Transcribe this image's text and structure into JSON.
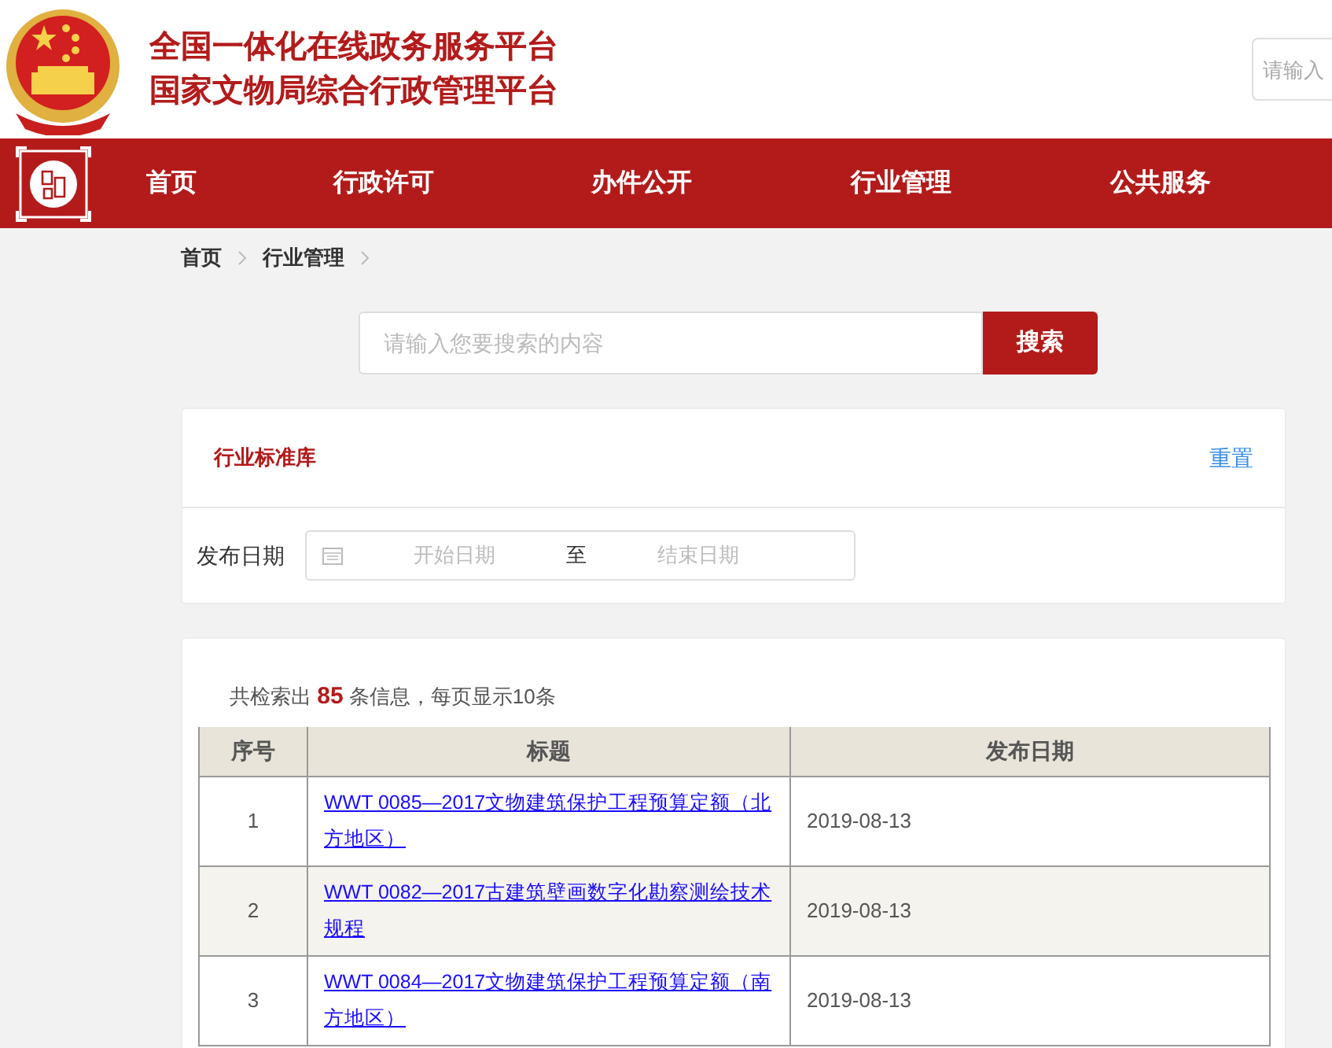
{
  "header": {
    "title_lines": [
      "全国一体化在线政务服务平台",
      "国家文物局综合行政管理平台"
    ],
    "search": {
      "placeholder": "请输入"
    }
  },
  "nav": {
    "items": [
      {
        "label": "首页",
        "selected": false
      },
      {
        "label": "行政许可",
        "selected": false
      },
      {
        "label": "办件公开",
        "selected": false
      },
      {
        "label": "行业管理",
        "selected": false
      },
      {
        "label": "公共服务",
        "selected": false
      }
    ]
  },
  "breadcrumb": [
    "首页",
    "行业管理"
  ],
  "search": {
    "placeholder": "请输入您要搜索的内容",
    "button": "搜索"
  },
  "filter": {
    "title": "行业标准库",
    "reset": "重置",
    "date_label": "发布日期",
    "start_placeholder": "开始日期",
    "separator": "至",
    "end_placeholder": "结束日期"
  },
  "results": {
    "summary": "共检索出 **85** 条信息，每页显示10条",
    "table": {
      "columns": [
        "序号",
        "标题",
        "发布日期"
      ],
      "rows": [
        {
          "no": "1",
          "title": "WWT 0085—2017文物建筑保护工程预算定额（北方地区）",
          "date": "2019-08-13"
        },
        {
          "no": "2",
          "title": "WWT 0082—2017古建筑壁画数字化勘察测绘技术规程",
          "date": "2019-08-13"
        },
        {
          "no": "3",
          "title": "WWT 0084—2017文物建筑保护工程预算定额（南方地区）",
          "date": "2019-08-13"
        }
      ]
    }
  }
}
